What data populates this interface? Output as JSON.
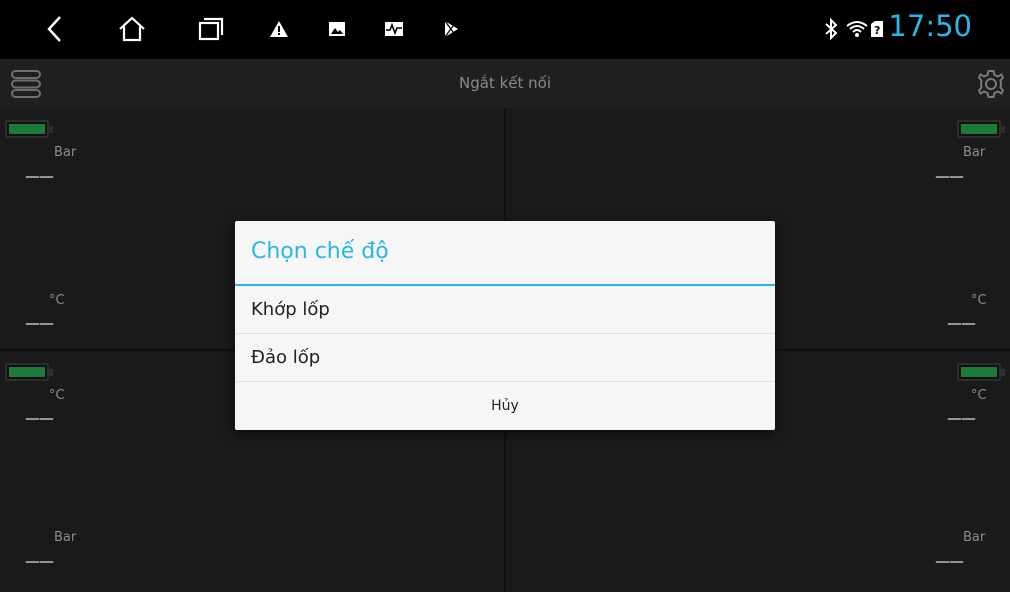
{
  "status_bar": {
    "time": "17:50",
    "nav_icons": [
      "back-icon",
      "home-icon",
      "recent-apps-icon",
      "warning-icon",
      "image-icon",
      "activity-icon",
      "play-store-icon"
    ],
    "status_icons": [
      "bluetooth-icon",
      "wifi-icon",
      "sim-unknown-icon"
    ],
    "accent": "#29b6e8"
  },
  "header": {
    "title": "Ngắt kết nối"
  },
  "tires": {
    "front_left": {
      "pressure_unit": "Bar",
      "pressure": "——",
      "temp_unit": "°C",
      "temp": "——"
    },
    "front_right": {
      "pressure_unit": "Bar",
      "pressure": "——",
      "temp_unit": "°C",
      "temp": "——"
    },
    "rear_left": {
      "temp_unit": "°C",
      "temp": "——",
      "pressure_unit": "Bar",
      "pressure": "——"
    },
    "rear_right": {
      "temp_unit": "°C",
      "temp": "——",
      "pressure_unit": "Bar",
      "pressure": "——"
    }
  },
  "dialog": {
    "title": "Chọn chế độ",
    "options": [
      "Khớp lốp",
      "Đảo lốp"
    ],
    "cancel": "Hủy"
  }
}
